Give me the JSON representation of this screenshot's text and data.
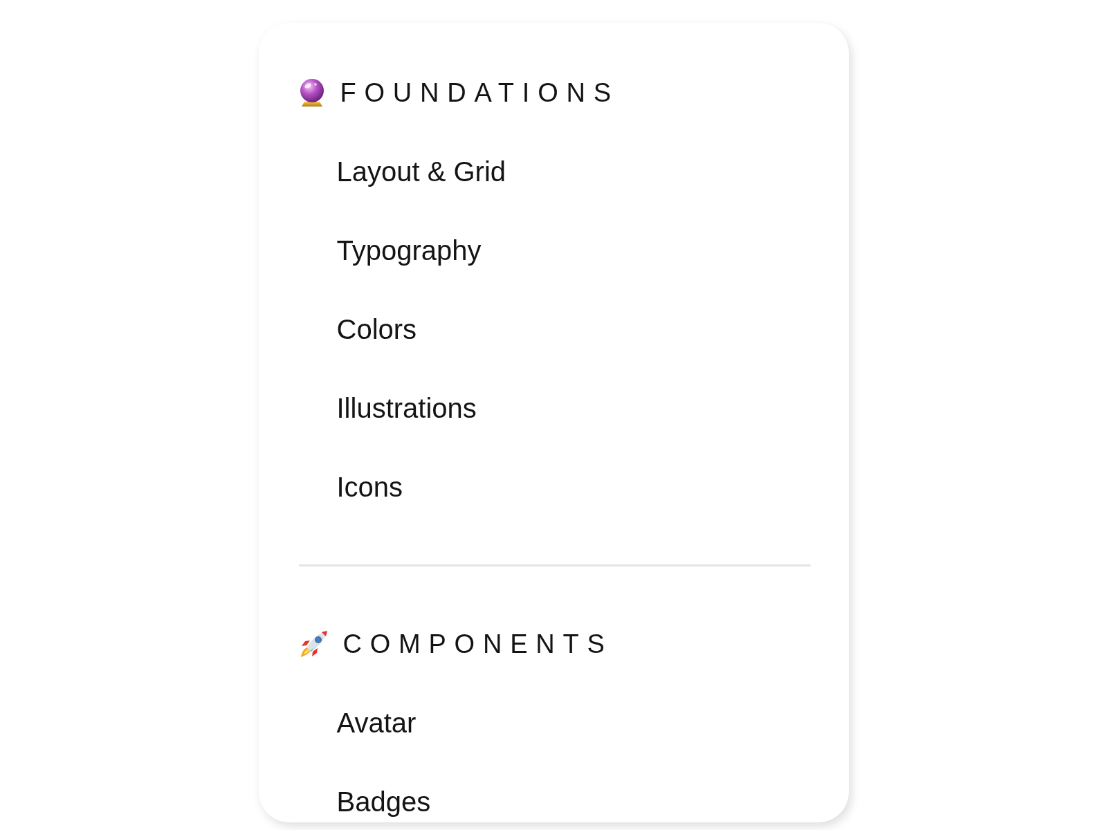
{
  "sections": [
    {
      "title": "FOUNDATIONS",
      "items": [
        "Layout & Grid",
        "Typography",
        "Colors",
        "Illustrations",
        "Icons"
      ]
    },
    {
      "title": "COMPONENTS",
      "items": [
        "Avatar",
        "Badges"
      ]
    }
  ]
}
